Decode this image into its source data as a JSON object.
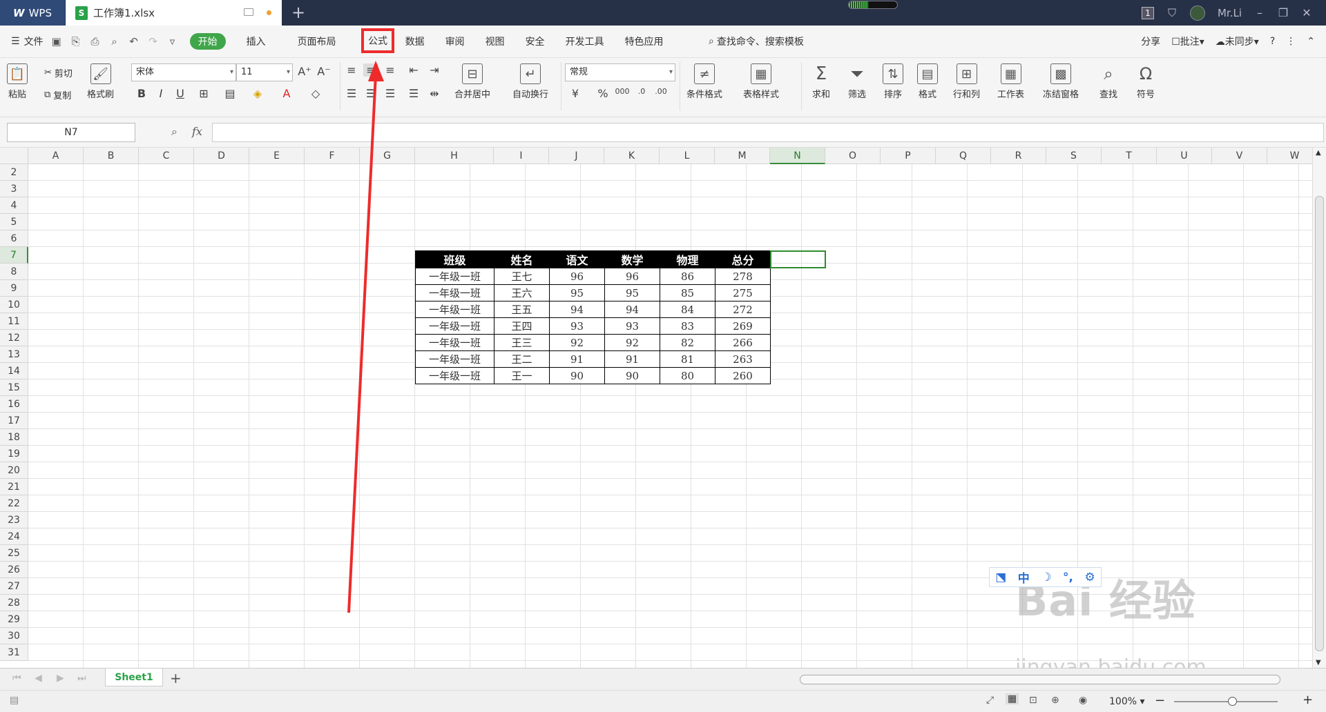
{
  "titlebar": {
    "app": "WPS",
    "tab_title": "工作簿1.xlsx",
    "badge": "1",
    "user": "Mr.Li"
  },
  "menu": {
    "file": "文件",
    "start": "开始",
    "items": [
      "插入",
      "页面布局",
      "公式",
      "数据",
      "审阅",
      "视图",
      "安全",
      "开发工具",
      "特色应用"
    ],
    "search": "查找命令、搜索模板",
    "share": "分享",
    "comment": "批注",
    "sync": "未同步"
  },
  "ribbon": {
    "paste": "粘贴",
    "cut": "剪切",
    "copy": "复制",
    "format_painter": "格式刷",
    "font": "宋体",
    "font_size": "11",
    "merge": "合并居中",
    "wrap": "自动换行",
    "number_format": "常规",
    "cond_format": "条件格式",
    "table_style": "表格样式",
    "sum": "求和",
    "filter": "筛选",
    "sort": "排序",
    "format": "格式",
    "rowcol": "行和列",
    "sheet": "工作表",
    "freeze": "冻结窗格",
    "find": "查找",
    "symbol": "符号"
  },
  "formula_bar": {
    "name_box": "N7",
    "fx": "fx",
    "value": ""
  },
  "columns": [
    "A",
    "B",
    "C",
    "D",
    "E",
    "F",
    "G",
    "H",
    "I",
    "J",
    "K",
    "L",
    "M",
    "N",
    "O",
    "P",
    "Q",
    "R",
    "S",
    "T",
    "U",
    "V",
    "W"
  ],
  "rows": [
    "2",
    "3",
    "4",
    "5",
    "6",
    "7",
    "8",
    "9",
    "10",
    "11",
    "12",
    "13",
    "14",
    "15",
    "16",
    "17",
    "18",
    "19",
    "20",
    "21",
    "22",
    "23",
    "24",
    "25",
    "26",
    "27",
    "28",
    "29",
    "30",
    "31"
  ],
  "table": {
    "headers": [
      "班级",
      "姓名",
      "语文",
      "数学",
      "物理",
      "总分"
    ],
    "rows": [
      [
        "一年级一班",
        "王七",
        "96",
        "96",
        "86",
        "278"
      ],
      [
        "一年级一班",
        "王六",
        "95",
        "95",
        "85",
        "275"
      ],
      [
        "一年级一班",
        "王五",
        "94",
        "94",
        "84",
        "272"
      ],
      [
        "一年级一班",
        "王四",
        "93",
        "93",
        "83",
        "269"
      ],
      [
        "一年级一班",
        "王三",
        "92",
        "92",
        "82",
        "266"
      ],
      [
        "一年级一班",
        "王二",
        "91",
        "91",
        "81",
        "263"
      ],
      [
        "一年级一班",
        "王一",
        "90",
        "90",
        "80",
        "260"
      ]
    ]
  },
  "sheet": {
    "tab": "Sheet1"
  },
  "status": {
    "zoom": "100%"
  },
  "ime": {
    "mode": "中"
  },
  "watermark": {
    "text": "Bai 经验",
    "url": "jingyan.baidu.com"
  },
  "colors": {
    "accent": "#40a64a",
    "highlight": "#ee2b2b",
    "titlebar": "#263147"
  }
}
